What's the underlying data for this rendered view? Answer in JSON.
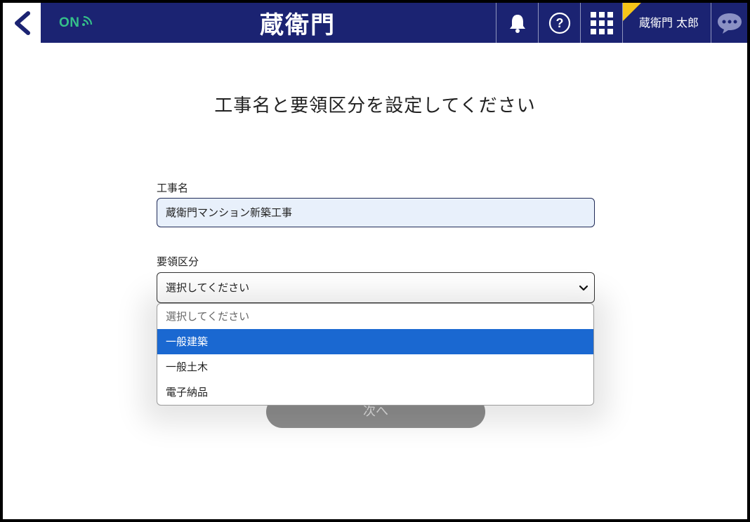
{
  "header": {
    "status_text": "ON",
    "logo_text": "蔵衛門",
    "user_name": "蔵衛門 太郎",
    "colors": {
      "bar": "#1b2372",
      "status": "#35c08a",
      "flag": "#f5c518"
    },
    "icons": [
      "back-chevron-icon",
      "wifi-icon",
      "bell-icon",
      "help-icon",
      "apps-grid-icon",
      "chat-bubble-icon"
    ]
  },
  "main": {
    "title": "工事名と要領区分を設定してください",
    "construction_name": {
      "label": "工事名",
      "value": "蔵衛門マンション新築工事"
    },
    "category": {
      "label": "要領区分",
      "selected": "選択してください",
      "options": [
        {
          "label": "選択してください"
        },
        {
          "label": "一般建築"
        },
        {
          "label": "一般土木"
        },
        {
          "label": "電子納品"
        }
      ],
      "highlighted_index": 1,
      "highlight_color": "#1a68d1"
    },
    "next_label": "次へ"
  }
}
